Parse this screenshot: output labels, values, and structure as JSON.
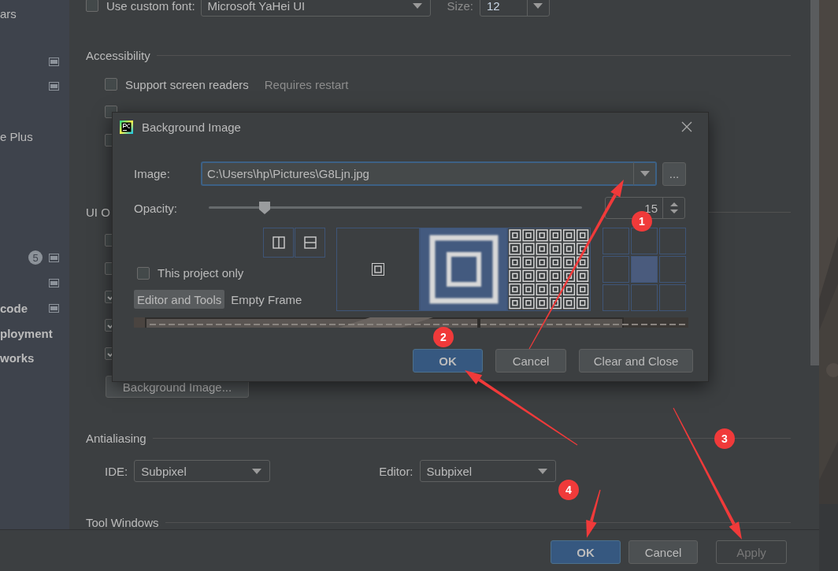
{
  "sidebar": {
    "items": [
      {
        "label": "ars",
        "kind": "item",
        "project_icon": false
      },
      {
        "kind": "item",
        "project_icon": true
      },
      {
        "kind": "item",
        "project_icon": true
      },
      {
        "label": "e Plus",
        "kind": "item",
        "project_icon": false
      },
      {
        "kind": "item",
        "badge": "5",
        "project_icon": true
      },
      {
        "kind": "item",
        "project_icon": true
      },
      {
        "label": "code",
        "kind": "group",
        "project_icon": true
      },
      {
        "label": "ployment",
        "kind": "group",
        "project_icon": false
      },
      {
        "label": "works",
        "kind": "group",
        "project_icon": false
      }
    ]
  },
  "custom_font": {
    "label": "Use custom font:",
    "checked": false,
    "font": "Microsoft YaHei UI",
    "size_label": "Size:",
    "size": "12"
  },
  "accessibility": {
    "title": "Accessibility",
    "options": [
      {
        "label": "Support screen readers",
        "note": "Requires restart",
        "checked": false
      },
      {
        "checked": false
      },
      {
        "checked": false
      }
    ]
  },
  "ui_options": {
    "title": "UI O",
    "options": [
      {
        "checked": false
      },
      {
        "checked": false
      },
      {
        "checked": true
      },
      {
        "checked": true
      },
      {
        "checked": true
      }
    ],
    "background_button": "Background Image..."
  },
  "antialiasing": {
    "title": "Antialiasing",
    "ide_label": "IDE:",
    "ide_value": "Subpixel",
    "editor_label": "Editor:",
    "editor_value": "Subpixel"
  },
  "tool_windows": {
    "title": "Tool Windows"
  },
  "buttons": [
    {
      "label": "OK",
      "kind": "default",
      "disabled": false
    },
    {
      "label": "Cancel",
      "kind": "normal",
      "disabled": false
    },
    {
      "label": "Apply",
      "kind": "normal",
      "disabled": true
    }
  ],
  "dialog": {
    "title": "Background Image",
    "image_label": "Image:",
    "image_path": "C:\\Users\\hp\\Pictures\\G8Ljn.jpg",
    "browse": "...",
    "opacity_label": "Opacity:",
    "opacity": {
      "level": 0.15
    },
    "opacity_value": "15",
    "this_project_only": {
      "label": "This project only",
      "checked": false
    },
    "targets": [
      {
        "label": "Editor and Tools",
        "selected": true
      },
      {
        "label": "Empty Frame",
        "selected": false
      }
    ],
    "fill_modes": [
      {
        "kind": "center",
        "selected": false
      },
      {
        "kind": "scale",
        "selected": true
      },
      {
        "kind": "tile",
        "selected": false
      }
    ],
    "anchors": [
      {
        "selected": false
      },
      {
        "selected": false
      },
      {
        "selected": false
      },
      {
        "selected": false
      },
      {
        "selected": true
      },
      {
        "selected": false
      },
      {
        "selected": false
      },
      {
        "selected": false
      },
      {
        "selected": false
      }
    ],
    "buttons": [
      {
        "label": "OK",
        "kind": "default"
      },
      {
        "label": "Cancel",
        "kind": "normal"
      },
      {
        "label": "Clear and Close",
        "kind": "normal"
      }
    ]
  },
  "annotations": [
    {
      "number": "1"
    },
    {
      "number": "2"
    },
    {
      "number": "3"
    },
    {
      "number": "4"
    }
  ]
}
